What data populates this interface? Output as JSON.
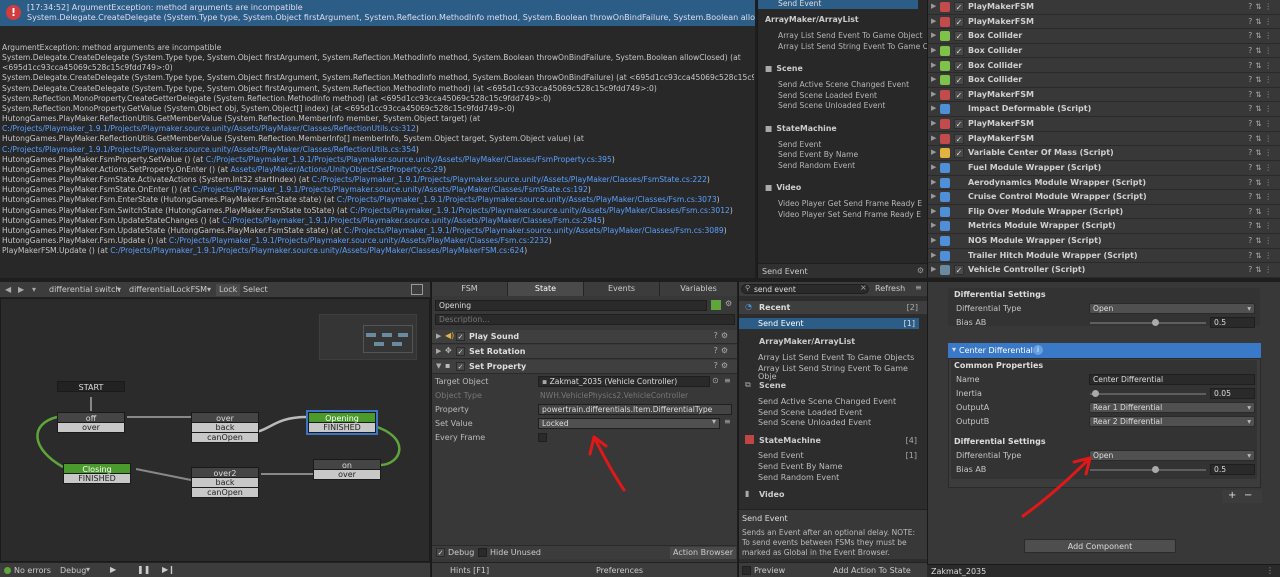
{
  "console": {
    "error_time": "[17:34:52] ArgumentException: method arguments are incompatible",
    "error_line2": "System.Delegate.CreateDelegate (System.Type type, System.Object firstArgument, System.Reflection.MethodInfo method, System.Boolean throwOnBindFailure, System.Boolean allowClosed) (at <",
    "error_badge": "!",
    "trace": [
      {
        "t": "ArgumentException: method arguments are incompatible",
        "l": ""
      },
      {
        "t": "System.Delegate.CreateDelegate (System.Type type, System.Object firstArgument, System.Reflection.MethodInfo method, System.Boolean throwOnBindFailure, System.Boolean allowClosed) (at",
        "l": ""
      },
      {
        "t": "<695d1cc93cca45069c528c15c9fdd749>:0)",
        "l": ""
      },
      {
        "t": "System.Delegate.CreateDelegate (System.Type type, System.Object firstArgument, System.Reflection.MethodInfo method, System.Boolean throwOnBindFailure) (at <695d1cc93cca45069c528c15c9fdd749>:0)",
        "l": ""
      },
      {
        "t": "System.Delegate.CreateDelegate (System.Type type, System.Object firstArgument, System.Reflection.MethodInfo method) (at <695d1cc93cca45069c528c15c9fdd749>:0)",
        "l": ""
      },
      {
        "t": "System.Reflection.MonoProperty.CreateGetterDelegate (System.Reflection.MethodInfo method) (at <695d1cc93cca45069c528c15c9fdd749>:0)",
        "l": ""
      },
      {
        "t": "System.Reflection.MonoProperty.GetValue (System.Object obj, System.Object[] index) (at <695d1cc93cca45069c528c15c9fdd749>:0)",
        "l": ""
      },
      {
        "t": "HutongGames.PlayMaker.ReflectionUtils.GetMemberValue (System.Reflection.MemberInfo member, System.Object target) (at",
        "l": ""
      },
      {
        "t": "",
        "l": "C:/Projects/Playmaker_1.9.1/Projects/Playmaker.source.unity/Assets/PlayMaker/Classes/ReflectionUtils.cs:312",
        "s": ")"
      },
      {
        "t": "HutongGames.PlayMaker.ReflectionUtils.GetMemberValue (System.Reflection.MemberInfo[] memberInfo, System.Object target, System.Object value) (at",
        "l": ""
      },
      {
        "t": "",
        "l": "C:/Projects/Playmaker_1.9.1/Projects/Playmaker.source.unity/Assets/PlayMaker/Classes/ReflectionUtils.cs:354",
        "s": ")"
      },
      {
        "t": "HutongGames.PlayMaker.FsmProperty.SetValue () (at ",
        "l": "C:/Projects/Playmaker_1.9.1/Projects/Playmaker.source.unity/Assets/PlayMaker/Classes/FsmProperty.cs:395",
        "s": ")"
      },
      {
        "t": "HutongGames.PlayMaker.Actions.SetProperty.OnEnter () (at ",
        "l": "Assets/PlayMaker/Actions/UnityObject/SetProperty.cs:29",
        "s": ")"
      },
      {
        "t": "HutongGames.PlayMaker.FsmState.ActivateActions (System.Int32 startIndex) (at ",
        "l": "C:/Projects/Playmaker_1.9.1/Projects/Playmaker.source.unity/Assets/PlayMaker/Classes/FsmState.cs:222",
        "s": ")"
      },
      {
        "t": "HutongGames.PlayMaker.FsmState.OnEnter () (at ",
        "l": "C:/Projects/Playmaker_1.9.1/Projects/Playmaker.source.unity/Assets/PlayMaker/Classes/FsmState.cs:192",
        "s": ")"
      },
      {
        "t": "HutongGames.PlayMaker.Fsm.EnterState (HutongGames.PlayMaker.FsmState state) (at ",
        "l": "C:/Projects/Playmaker_1.9.1/Projects/Playmaker.source.unity/Assets/PlayMaker/Classes/Fsm.cs:3073",
        "s": ")"
      },
      {
        "t": "HutongGames.PlayMaker.Fsm.SwitchState (HutongGames.PlayMaker.FsmState toState) (at ",
        "l": "C:/Projects/Playmaker_1.9.1/Projects/Playmaker.source.unity/Assets/PlayMaker/Classes/Fsm.cs:3012",
        "s": ")"
      },
      {
        "t": "HutongGames.PlayMaker.Fsm.UpdateStateChanges () (at ",
        "l": "C:/Projects/Playmaker_1.9.1/Projects/Playmaker.source.unity/Assets/PlayMaker/Classes/Fsm.cs:2945",
        "s": ")"
      },
      {
        "t": "HutongGames.PlayMaker.Fsm.UpdateState (HutongGames.PlayMaker.FsmState state) (at ",
        "l": "C:/Projects/Playmaker_1.9.1/Projects/Playmaker.source.unity/Assets/PlayMaker/Classes/Fsm.cs:3089",
        "s": ")"
      },
      {
        "t": "HutongGames.PlayMaker.Fsm.Update () (at ",
        "l": "C:/Projects/Playmaker_1.9.1/Projects/Playmaker.source.unity/Assets/PlayMaker/Classes/Fsm.cs:2232",
        "s": ")"
      },
      {
        "t": "PlayMakerFSM.Update () (at ",
        "l": "C:/Projects/Playmaker_1.9.1/Projects/Playmaker.source.unity/Assets/PlayMaker/Classes/PlayMakerFSM.cs:624",
        "s": ")"
      }
    ]
  },
  "actions_top": {
    "selected": "Send Event",
    "cats": [
      {
        "name": "ArrayMaker/ArrayList",
        "icon": "",
        "items": [
          "Array List Send Event To Game Object",
          "Array List Send String Event To Game Obj"
        ]
      },
      {
        "name": "Scene",
        "icon": "scene-icon",
        "items": [
          "Send Active Scene Changed Event",
          "Send Scene Loaded Event",
          "Send Scene Unloaded Event"
        ]
      },
      {
        "name": "StateMachine",
        "icon": "statemachine-icon",
        "items": [
          "Send Event",
          "Send Event By Name",
          "Send Random Event"
        ]
      },
      {
        "name": "Video",
        "icon": "video-icon",
        "items": [
          "Video Player Get Send Frame Ready E",
          "Video Player Set Send Frame Ready E"
        ]
      }
    ],
    "footer": "Send Event"
  },
  "inspector_top": {
    "components": [
      {
        "name": "PlayMakerFSM",
        "icon": "fsm"
      },
      {
        "name": "PlayMakerFSM",
        "icon": "fsm"
      },
      {
        "name": "Box Collider",
        "icon": "box"
      },
      {
        "name": "Box Collider",
        "icon": "box"
      },
      {
        "name": "Box Collider",
        "icon": "box"
      },
      {
        "name": "Box Collider",
        "icon": "box"
      },
      {
        "name": "PlayMakerFSM",
        "icon": "fsm"
      },
      {
        "name": "Impact Deformable (Script)",
        "icon": "script",
        "nocheck": true
      },
      {
        "name": "PlayMakerFSM",
        "icon": "fsm"
      },
      {
        "name": "PlayMakerFSM",
        "icon": "fsm"
      },
      {
        "name": "Variable Center Of Mass (Script)",
        "icon": "com"
      },
      {
        "name": "Fuel Module Wrapper (Script)",
        "icon": "script",
        "nocheck": true
      },
      {
        "name": "Aerodynamics Module Wrapper (Script)",
        "icon": "script",
        "nocheck": true
      },
      {
        "name": "Cruise Control Module Wrapper (Script)",
        "icon": "script",
        "nocheck": true
      },
      {
        "name": "Flip Over Module Wrapper (Script)",
        "icon": "script",
        "nocheck": true
      },
      {
        "name": "Metrics Module Wrapper (Script)",
        "icon": "script",
        "nocheck": true
      },
      {
        "name": "NOS Module Wrapper (Script)",
        "icon": "script",
        "nocheck": true
      },
      {
        "name": "Trailer Hitch Module Wrapper (Script)",
        "icon": "script",
        "nocheck": true
      },
      {
        "name": "Vehicle Controller (Script)",
        "icon": "vc"
      }
    ]
  },
  "pm": {
    "fsm_select": "differential switch",
    "fsm_name": "differentialLockFSM",
    "lock": "Lock",
    "select": "Select",
    "start": "START",
    "states": {
      "off": {
        "name": "off",
        "ev": "over"
      },
      "over": {
        "name": "over",
        "ev1": "back",
        "ev2": "canOpen"
      },
      "opening": {
        "name": "Opening",
        "ev": "FINISHED"
      },
      "closing": {
        "name": "Closing",
        "ev": "FINISHED"
      },
      "on": {
        "name": "on",
        "ev": "over"
      },
      "over2": {
        "name": "over2",
        "ev1": "back",
        "ev2": "canOpen"
      }
    },
    "foot": {
      "errors": "No errors",
      "debug": "Debug",
      "hints": "Hints [F1]",
      "prefs": "Preferences"
    }
  },
  "state": {
    "tabs": [
      "FSM",
      "State",
      "Events",
      "Variables"
    ],
    "name": "Opening",
    "desc_placeholder": "Description...",
    "actions": [
      "Play Sound",
      "Set Rotation",
      "Set Property"
    ],
    "target_label": "Target Object",
    "target_value": "Zakmat_2035 (Vehicle Controller)",
    "type_label": "Object Type",
    "type_value": "NWH.VehiclePhysics2.VehicleController",
    "prop_label": "Property",
    "prop_value": "powertrain.differentials.Item.DifferentialType",
    "setval_label": "Set Value",
    "setval_value": "Locked",
    "every_label": "Every Frame",
    "debug": "Debug",
    "hide_unused": "Hide Unused",
    "action_browser": "Action Browser"
  },
  "abr": {
    "search": "send event",
    "refresh": "Refresh",
    "recent": "Recent",
    "recent_count": "[2]",
    "selected": "Send Event",
    "selected_count": "[1]",
    "arraylist": "ArrayMaker/ArrayList",
    "al_items": [
      "Array List Send Event To Game Objects",
      "Array List Send String Event To Game Obje"
    ],
    "scene": "Scene",
    "scene_items": [
      "Send Active Scene Changed Event",
      "Send Scene Loaded Event",
      "Send Scene Unloaded Event"
    ],
    "sm": "StateMachine",
    "sm_count": "[4]",
    "sm_items": [
      "Send Event",
      "Send Event By Name",
      "Send Random Event"
    ],
    "sm_count2": "[1]",
    "video": "Video",
    "desc_title": "Send Event",
    "desc": "Sends an Event after an optional delay. NOTE: To send events between FSMs they must be marked as Global in the Event Browser.",
    "preview": "Preview",
    "add_action": "Add Action To State"
  },
  "inspb": {
    "ds_header": "Differential Settings",
    "dt_label": "Differential Type",
    "dt_value": "Open",
    "bias_label": "Bias AB",
    "bias_value": "0.5",
    "cd_header": "Center Differential",
    "cp_header": "Common Properties",
    "name_label": "Name",
    "name_value": "Center Differential",
    "inertia_label": "Inertia",
    "inertia_value": "0.05",
    "oa_label": "OutputA",
    "oa_value": "Rear 1 Differential",
    "ob_label": "OutputB",
    "ob_value": "Rear 2 Differential",
    "ds2_header": "Differential Settings",
    "dt2_label": "Differential Type",
    "dt2_value": "Open",
    "bias2_label": "Bias AB",
    "bias2_value": "0.5",
    "plus": "+",
    "minus": "−",
    "add_component": "Add Component",
    "footer": "Zakmat_2035"
  }
}
